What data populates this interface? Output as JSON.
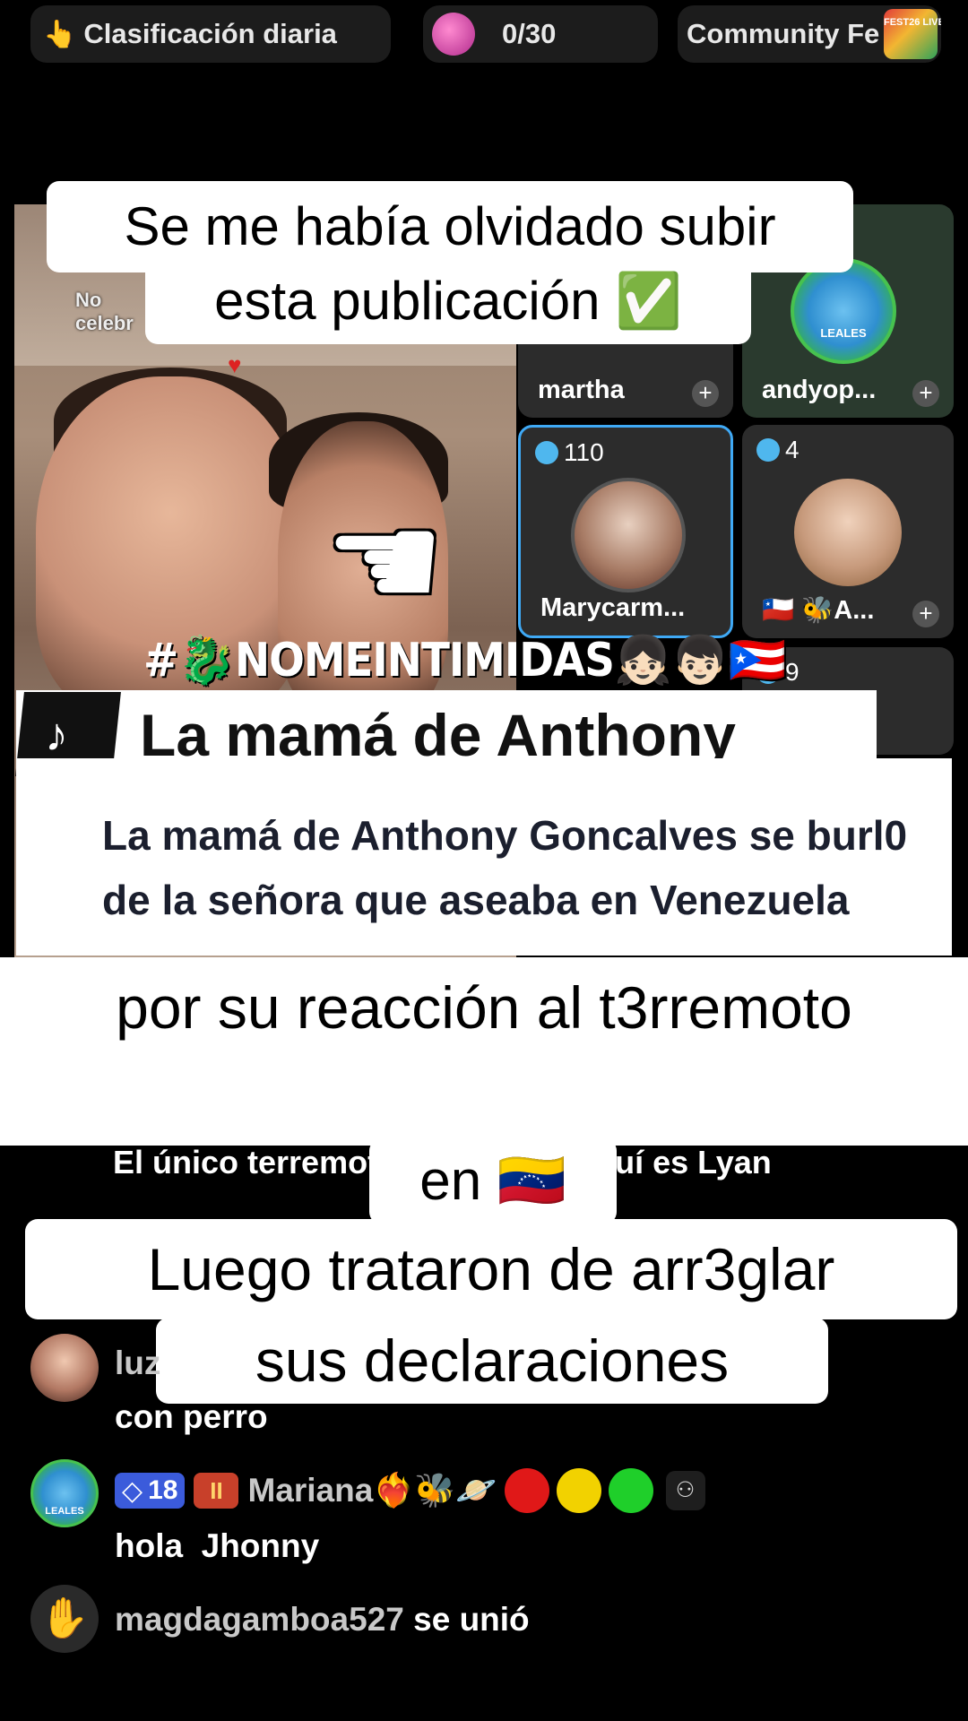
{
  "top_bar": {
    "rank_emoji": "👆",
    "rank_label": "Clasificación diaria",
    "count_label": "0/30",
    "community_label": "Community Fe",
    "fest_badge_text": "FEST26 LIVE"
  },
  "video": {
    "top_text": "No\ncelebr"
  },
  "guests": [
    {
      "name": "martha",
      "score": ""
    },
    {
      "name": "andyop...",
      "score": "",
      "avatar_text": "LEALES"
    },
    {
      "name": "Marycarm...",
      "score": "110"
    },
    {
      "name": "🇨🇱 🐝A...",
      "score": "4"
    },
    {
      "name": "",
      "score": "9"
    }
  ],
  "captions": {
    "line1": "Se me había olvidado subir",
    "line2": "esta publicación ✅",
    "hashtag": "#🐉NOMEINTIMIDAS👧🏻👦🏻🇵🇷",
    "tiktok_title": "La mamá de Anthony",
    "description": "La mamá de Anthony Goncalves se burl0 de la señora que aseaba en Venezuela",
    "dot": ".",
    "line3": "por su reacción al t3rremoto",
    "line4": "en 🇻🇪",
    "line5": "Luego trataron de arr3glar",
    "line6": "sus declaraciones"
  },
  "comments": [
    {
      "text": "El único terremoto que queda aquí es Lyan"
    },
    {
      "user": "luz",
      "message": "con perro"
    },
    {
      "level": "18",
      "fan_badge": "II",
      "user": "Mariana❤️‍🔥🐝🪐",
      "message": "hola  Jhonny",
      "avatar_text": "LEALES"
    },
    {
      "user": "magdagamboa527",
      "action": "se unió"
    }
  ],
  "colors": {
    "background": "#000000",
    "pill": "#1c1c1c",
    "caption_bg": "#ffffff",
    "gem": "#4fb7ee",
    "level_badge": "#3b5bdb",
    "dot_red": "#e01818",
    "dot_yellow": "#f2d200",
    "dot_green": "#1fcf2a"
  },
  "icons": [
    "finger-up-icon",
    "heart-badge-icon",
    "gem-icon",
    "add-guest-icon",
    "pointing-hand-icon",
    "tiktok-logo-icon",
    "wave-hand-icon",
    "share-icon"
  ]
}
